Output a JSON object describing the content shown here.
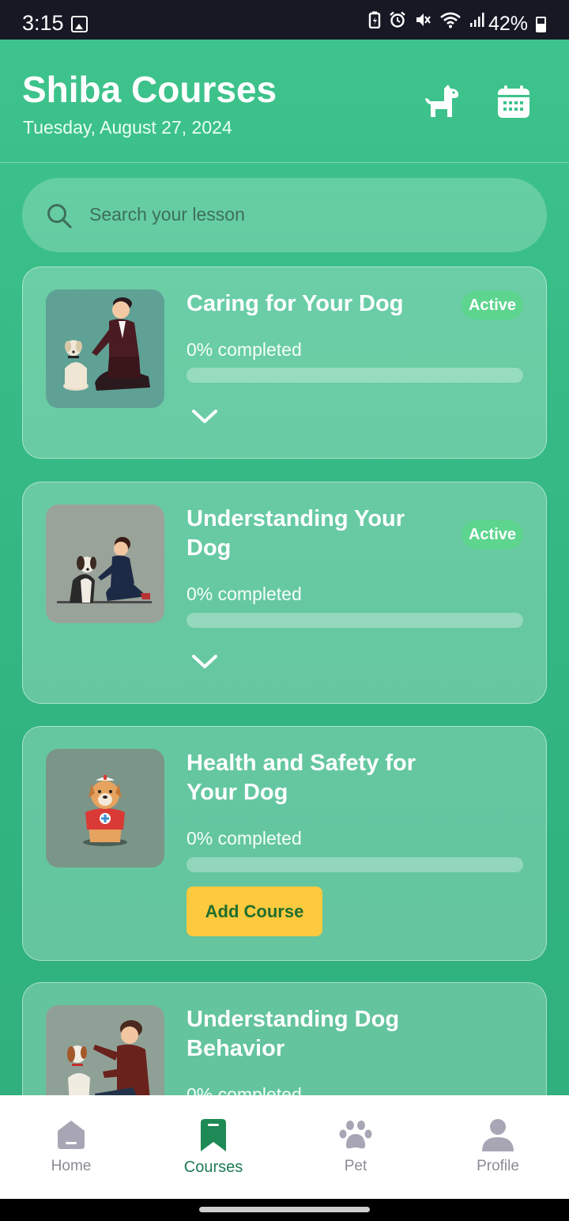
{
  "status_bar": {
    "time": "3:15",
    "battery": "42%"
  },
  "header": {
    "title": "Shiba Courses",
    "date": "Tuesday, August 27, 2024",
    "pet_icon": "dog-icon",
    "calendar_icon": "calendar-icon"
  },
  "search": {
    "placeholder": "Search your lesson",
    "icon": "search-icon"
  },
  "courses": [
    {
      "title": "Caring for Your Dog",
      "status": "Active",
      "progress_label": "0% completed",
      "progress": 0,
      "action": "expand"
    },
    {
      "title": "Understanding Your Dog",
      "status": "Active",
      "progress_label": "0% completed",
      "progress": 0,
      "action": "expand"
    },
    {
      "title": "Health and Safety for Your Dog",
      "status": "",
      "progress_label": "0% completed",
      "progress": 0,
      "action": "Add Course"
    },
    {
      "title": "Understanding Dog Behavior",
      "status": "",
      "progress_label": "0% completed",
      "progress": 0,
      "action": ""
    }
  ],
  "bottom_nav": [
    {
      "label": "Home",
      "icon": "home-icon",
      "active": false
    },
    {
      "label": "Courses",
      "icon": "bookmark-icon",
      "active": true
    },
    {
      "label": "Pet",
      "icon": "paw-icon",
      "active": false
    },
    {
      "label": "Profile",
      "icon": "person-icon",
      "active": false
    }
  ],
  "colors": {
    "primary_green": "#3ec38c",
    "active_badge": "#5dd58e",
    "add_button": "#fcc93f",
    "nav_active": "#1e7a53",
    "nav_inactive": "#8a8c94"
  }
}
